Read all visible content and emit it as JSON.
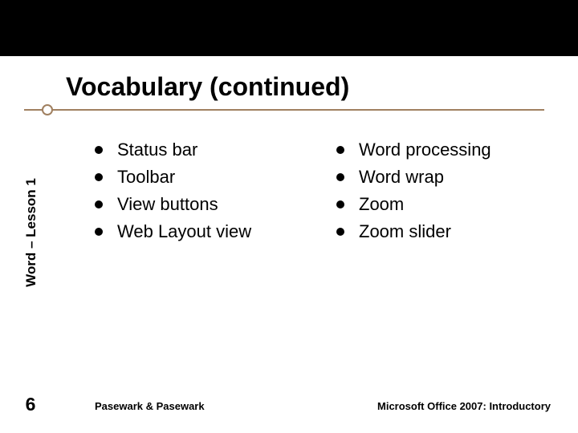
{
  "title": "Vocabulary (continued)",
  "sidebar_label": "Word – Lesson 1",
  "columns": {
    "left": [
      "Status bar",
      "Toolbar",
      "View buttons",
      "Web Layout view"
    ],
    "right": [
      "Word processing",
      "Word wrap",
      "Zoom",
      "Zoom slider"
    ]
  },
  "page_number": "6",
  "footer_left": "Pasewark & Pasewark",
  "footer_right": "Microsoft Office 2007:  Introductory"
}
